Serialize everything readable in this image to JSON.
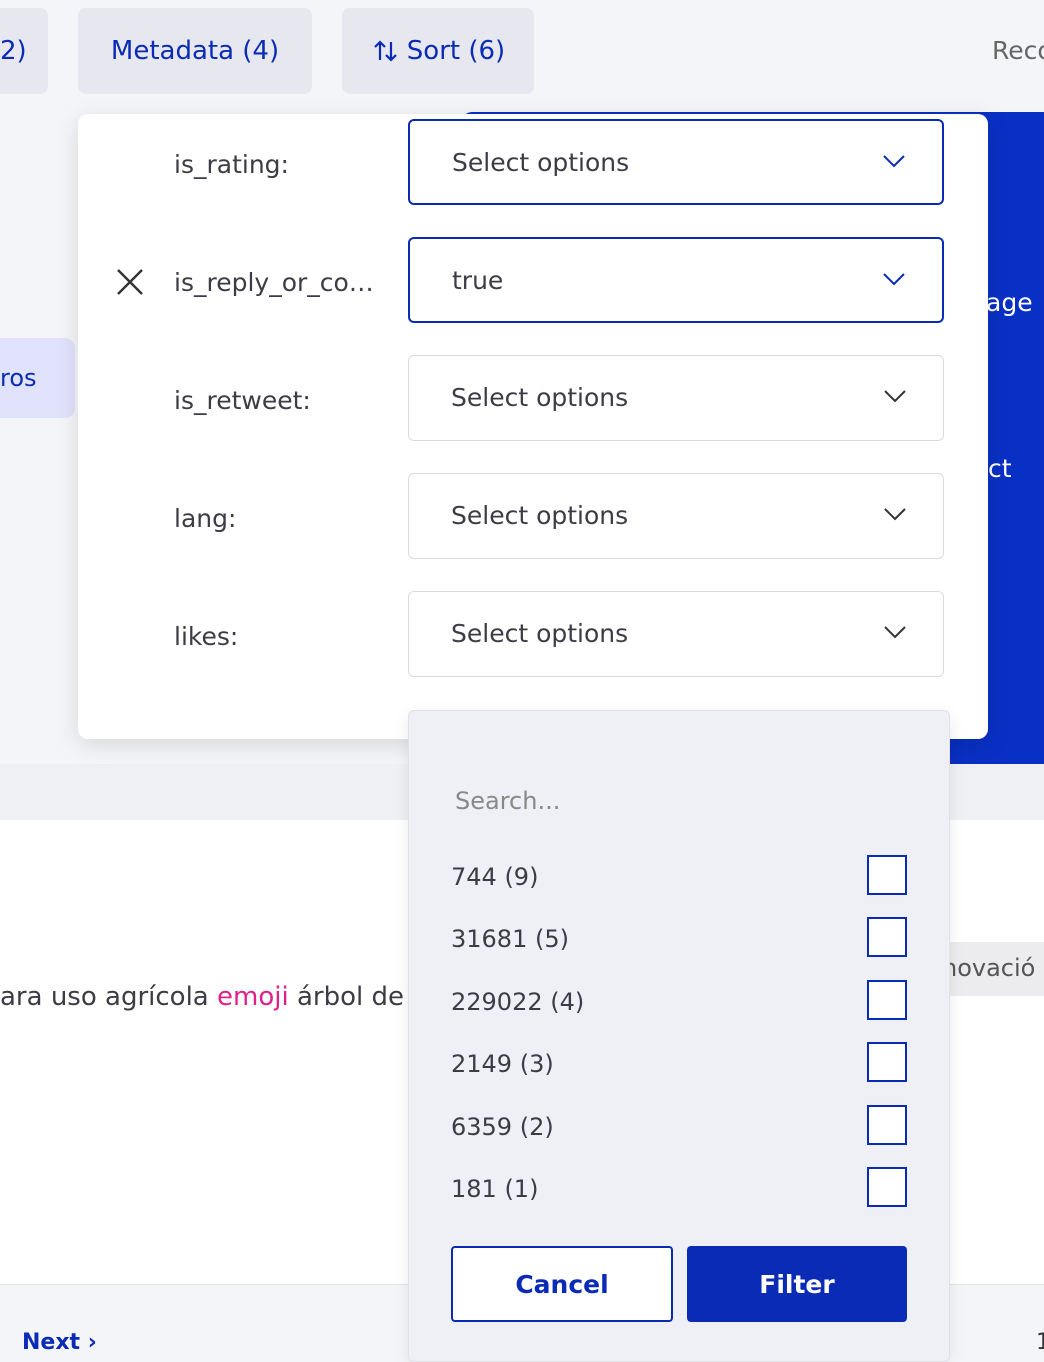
{
  "toolbar": {
    "partial_label": "2)",
    "metadata_label": "Metadata (4)",
    "sort_label": "Sort (6)",
    "reco_label": "Reco"
  },
  "background": {
    "pill_label": "ros",
    "blue_text_1": "age",
    "blue_text_2": "ct",
    "content_text_prefix": "ara uso agrícola ",
    "content_text_highlight": "emoji",
    "content_text_suffix": " árbol de",
    "tag_label": "novació",
    "next_label": "Next ›",
    "page_number": "1"
  },
  "filters": [
    {
      "label": "is_rating:",
      "value": "Select options",
      "active": true
    },
    {
      "label": "is_reply_or_co…",
      "value": "true",
      "active": true
    },
    {
      "label": "is_retweet:",
      "value": "Select options",
      "active": false
    },
    {
      "label": "lang:",
      "value": "Select options",
      "active": false
    },
    {
      "label": "likes:",
      "value": "Select options",
      "active": false
    }
  ],
  "dropdown": {
    "search_placeholder": "Search...",
    "options": [
      "744 (9)",
      "31681 (5)",
      "229022 (4)",
      "2149 (3)",
      "6359 (2)",
      "181 (1)"
    ],
    "cancel_label": "Cancel",
    "filter_label": "Filter"
  },
  "colors": {
    "accent": "#0a2bb5",
    "highlight": "#e0218a"
  }
}
